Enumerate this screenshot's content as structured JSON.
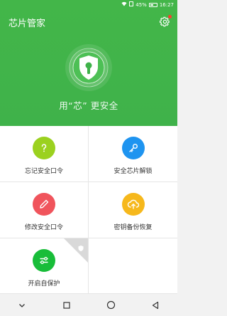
{
  "status": {
    "battery": "45%",
    "time": "16:27"
  },
  "app": {
    "title": "芯片管家",
    "slogan": "用“芯” 更安全"
  },
  "tiles": [
    {
      "label": "忘记安全口令",
      "color": "#9bd11f",
      "icon": "question-icon"
    },
    {
      "label": "安全芯片解锁",
      "color": "#1e94f0",
      "icon": "key-icon"
    },
    {
      "label": "修改安全口令",
      "color": "#f0545c",
      "icon": "pen-icon"
    },
    {
      "label": "密钥备份恢复",
      "color": "#f6b81c",
      "icon": "cloud-upload-icon"
    },
    {
      "label": "开启自保护",
      "color": "#18bd39",
      "icon": "toggle-icon"
    }
  ],
  "nav": [
    "back-chevron-icon",
    "square-icon",
    "circle-icon",
    "triangle-back-icon"
  ]
}
